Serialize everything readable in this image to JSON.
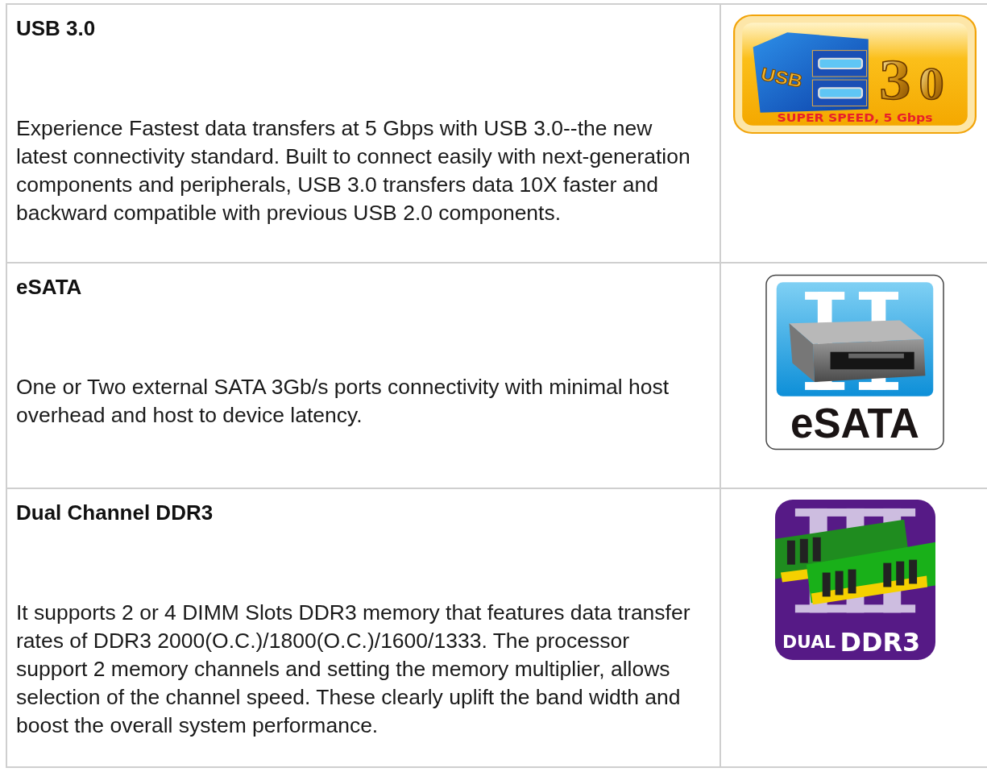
{
  "features": [
    {
      "title": "USB 3.0",
      "lines": [
        "Experience Fastest data transfers at 5 Gbps with USB 3.0--the new",
        "latest connectivity standard. Built to connect easily with next-generation",
        "components and peripherals, USB 3.0 transfers data 10X faster and",
        "backward compatible with previous USB 2.0 components."
      ],
      "logo": {
        "kind": "usb",
        "texts": [
          "USB",
          "3",
          "0",
          "SUPER SPEED, 5 Gbps"
        ]
      }
    },
    {
      "title": "eSATA",
      "lines": [
        "One or Two external SATA 3Gb/s ports connectivity with minimal host",
        "overhead and host to device latency."
      ],
      "logo": {
        "kind": "esata",
        "texts": [
          "eSATA"
        ]
      }
    },
    {
      "title": "Dual Channel DDR3",
      "lines": [
        "It supports 2 or 4 DIMM Slots DDR3 memory that features data transfer",
        "rates of DDR3 2000(O.C.)/1800(O.C.)/1600/1333. The processor",
        "support 2 memory channels and setting the memory multiplier, allows",
        "selection of the channel speed. These clearly uplift the band width and",
        "boost the overall system performance."
      ],
      "logo": {
        "kind": "ddr3",
        "texts": [
          "DUAL",
          "DDR3"
        ]
      }
    }
  ]
}
